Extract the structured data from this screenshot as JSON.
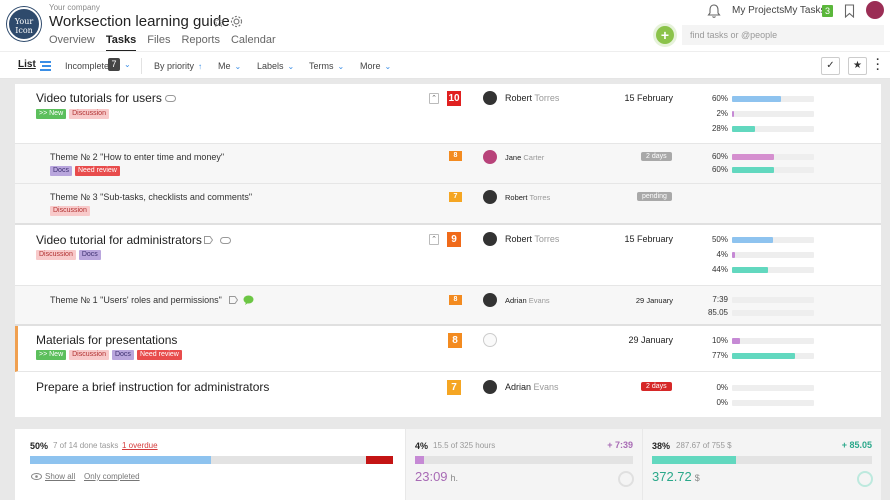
{
  "header": {
    "logo_text": "Your Icon",
    "company": "Your company",
    "project_title": "Worksection learning guide",
    "nav": [
      "Overview",
      "Tasks",
      "Files",
      "Reports",
      "Calendar"
    ],
    "active_nav": "Tasks",
    "my_projects": "My Projects",
    "my_tasks": "My Tasks",
    "my_tasks_count": "3",
    "search_placeholder": "find tasks or @people",
    "add_icon": "plus-icon"
  },
  "toolbar": {
    "list": "List",
    "incomplete": "Incomplete",
    "incomplete_count": "7",
    "by_priority": "By priority",
    "me": "Me",
    "labels": "Labels",
    "terms": "Terms",
    "more": "More"
  },
  "tasks": [
    {
      "title": "Video tutorials for users",
      "tags": [
        ">> New",
        "Discussion"
      ],
      "priority": "10",
      "assignee_first": "Robert",
      "assignee_last": "Torres",
      "date": "15 February",
      "metrics": [
        {
          "pct": "60%",
          "value": 60,
          "color": "blue"
        },
        {
          "pct": "2%",
          "value": 2,
          "color": "purple"
        },
        {
          "pct": "28%",
          "value": 28,
          "color": "teal"
        }
      ]
    },
    {
      "title": "Theme № 2 \"How to enter time and money\"",
      "tags": [
        "Docs",
        "Need review"
      ],
      "priority": "8",
      "assignee_first": "Jane",
      "assignee_last": "Carter",
      "status": "2 days",
      "metrics": [
        {
          "pct": "60%",
          "value": 60,
          "color": "pink"
        },
        {
          "pct": "60%",
          "value": 60,
          "color": "teal"
        }
      ]
    },
    {
      "title": "Theme № 3 \"Sub-tasks, checklists and comments\"",
      "tags": [
        "Discussion"
      ],
      "priority": "7",
      "assignee_first": "Robert",
      "assignee_last": "Torres",
      "status": "pending"
    },
    {
      "title": "Video tutorial for administrators",
      "tags": [
        "Discussion",
        "Docs"
      ],
      "priority": "9",
      "assignee_first": "Robert",
      "assignee_last": "Torres",
      "date": "15 February",
      "metrics": [
        {
          "pct": "50%",
          "value": 50,
          "color": "blue"
        },
        {
          "pct": "4%",
          "value": 4,
          "color": "purple"
        },
        {
          "pct": "44%",
          "value": 44,
          "color": "teal"
        }
      ]
    },
    {
      "title": "Theme № 1 \"Users' roles and permissions\"",
      "tags": [],
      "priority": "8",
      "assignee_first": "Adrian",
      "assignee_last": "Evans",
      "date": "29 January",
      "metrics": [
        {
          "pct": "7:39",
          "value": 0,
          "color": "purple"
        },
        {
          "pct": "85.05",
          "value": 0,
          "color": "teal"
        }
      ]
    },
    {
      "title": "Materials for presentations",
      "tags": [
        ">> New",
        "Discussion",
        "Docs",
        "Need review"
      ],
      "priority": "8",
      "date": "29 January",
      "metrics": [
        {
          "pct": "10%",
          "value": 10,
          "color": "purple"
        },
        {
          "pct": "77%",
          "value": 77,
          "color": "teal"
        }
      ]
    },
    {
      "title": "Prepare a brief instruction for administrators",
      "tags": [],
      "priority": "7",
      "assignee_first": "Adrian",
      "assignee_last": "Evans",
      "status": "2 days",
      "metrics": [
        {
          "pct": "0%",
          "value": 0,
          "color": "purple"
        },
        {
          "pct": "0%",
          "value": 0,
          "color": "teal"
        }
      ]
    }
  ],
  "footer": {
    "done_pct": "50%",
    "done_text": "7 of 14 done tasks",
    "overdue": "1 overdue",
    "done_progress": 50,
    "show_all": "Show all",
    "only_completed": "Only completed",
    "time_pct": "4%",
    "time_text": "15.5 of 325 hours",
    "time_delta": "+ 7:39",
    "time_big": "23:09",
    "time_unit": "h.",
    "time_progress": 4,
    "money_pct": "38%",
    "money_text": "287.67 of 755 $",
    "money_delta": "+ 85.05",
    "money_big": "372.72",
    "money_unit": "$",
    "money_progress": 38
  },
  "colors": {
    "accent_blue": "#3a8ee6",
    "priority_red": "#e02020",
    "add_green": "#8bc34a",
    "progress_blue": "#8ec3ef",
    "progress_teal": "#62d8bf",
    "progress_purple": "#c68ad5"
  }
}
